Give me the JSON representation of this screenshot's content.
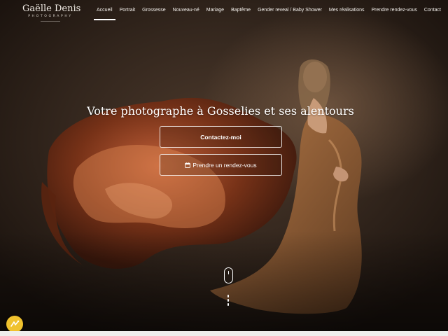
{
  "logo": {
    "name": "Gaëlle Denis",
    "subtitle": "PHOTOGRAPHY"
  },
  "nav": {
    "items": [
      {
        "label": "Accueil",
        "active": true
      },
      {
        "label": "Portrait"
      },
      {
        "label": "Grossesse"
      },
      {
        "label": "Nouveau-né"
      },
      {
        "label": "Mariage"
      },
      {
        "label": "Baptême"
      },
      {
        "label": "Gender reveal / Baby Shower"
      },
      {
        "label": "Mes réalisations"
      },
      {
        "label": "Prendre rendez-vous"
      },
      {
        "label": "Contact"
      }
    ]
  },
  "hero": {
    "title": "Votre photographe à Gosselies et ses alentours",
    "contact_button": "Contactez-moi",
    "appointment_button": "Prendre un rendez-vous"
  },
  "colors": {
    "text": "#ffffff",
    "badge": "#f0c22e",
    "background": "#3a2b21"
  },
  "icons": [
    "calendar-icon",
    "scroll-mouse-icon",
    "accessibility-badge-icon"
  ]
}
